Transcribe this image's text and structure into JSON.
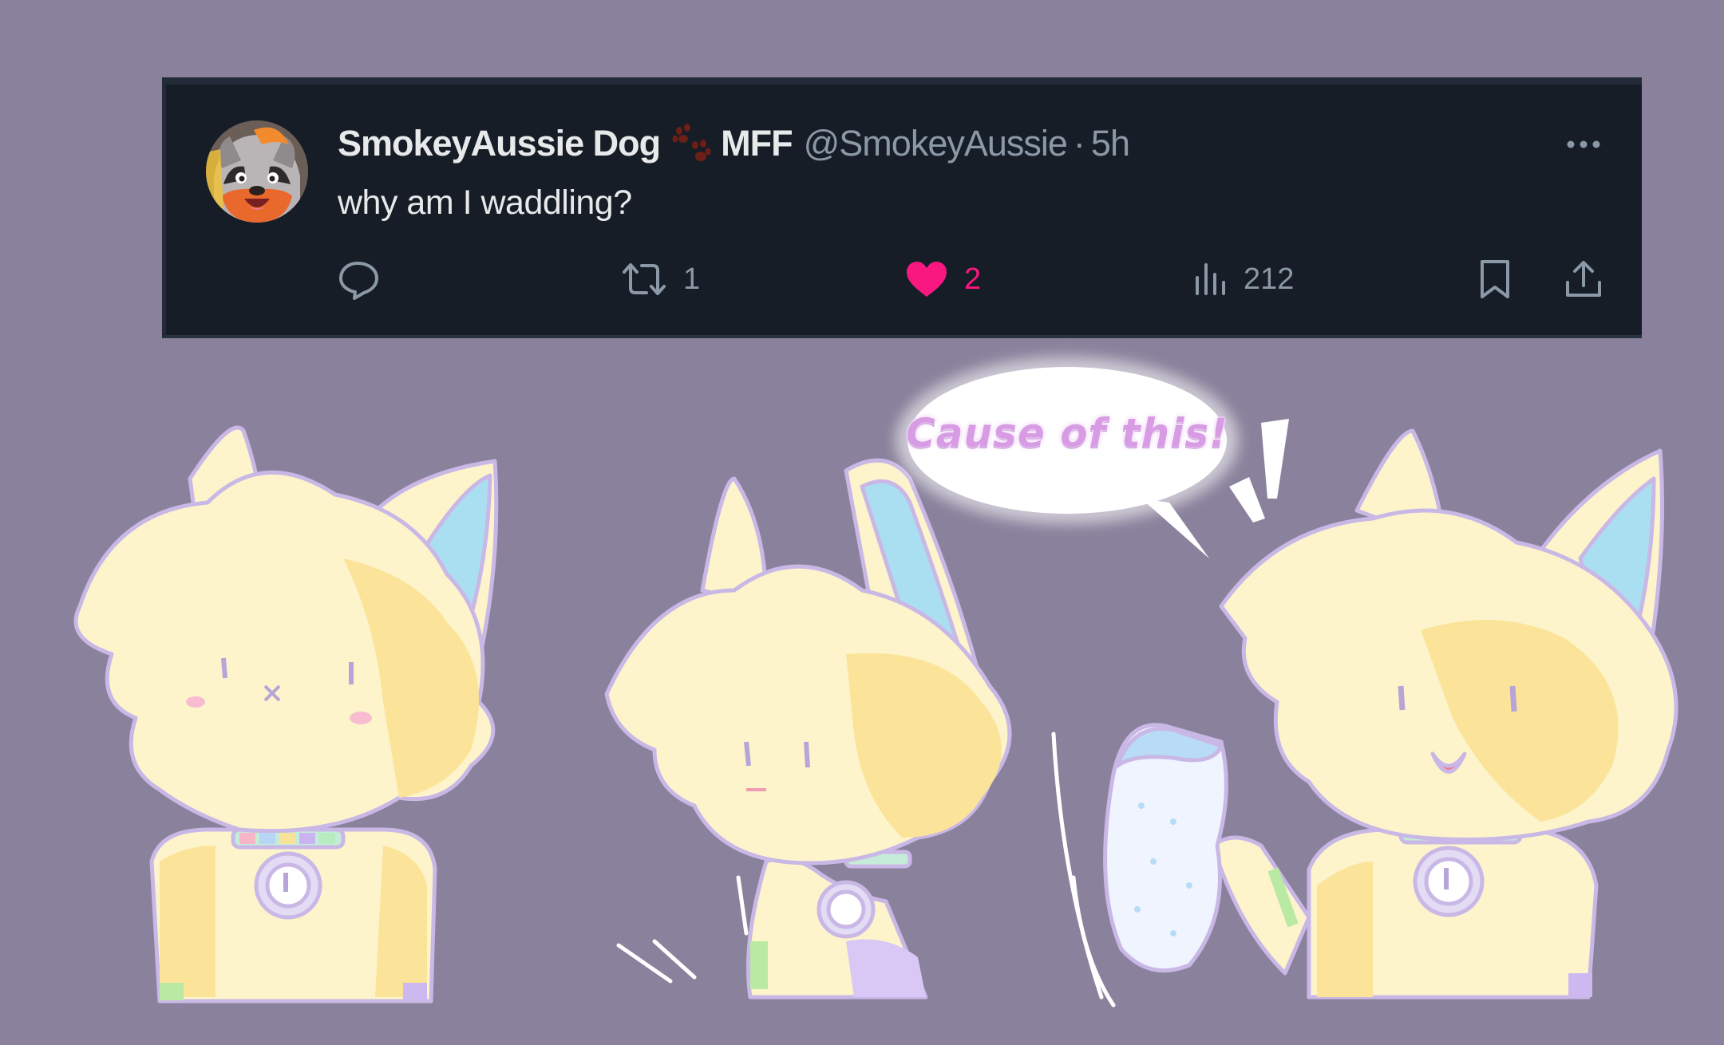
{
  "tweet": {
    "display_name": "SmokeyAussie Dog",
    "name_suffix": "MFF",
    "handle": "@SmokeyAussie",
    "separator": "·",
    "timestamp": "5h",
    "text": "why am I waddling?",
    "actions": {
      "retweets": "1",
      "likes": "2",
      "views": "212"
    },
    "icons": {
      "reply": "reply-icon",
      "retweet": "retweet-icon",
      "like": "heart-icon",
      "views": "views-icon",
      "bookmark": "bookmark-icon",
      "share": "share-icon",
      "more": "more-icon"
    },
    "like_color": "#f91880",
    "liked": true
  },
  "comic": {
    "speech_bubble": "Cause of this!"
  },
  "colors": {
    "background": "#8a829c",
    "card": "#161d27",
    "fur": "#fdf4cc",
    "fur_shade": "#fbe49a",
    "ear_inner": "#a9dff1",
    "lineart": "#b8a4d6"
  }
}
